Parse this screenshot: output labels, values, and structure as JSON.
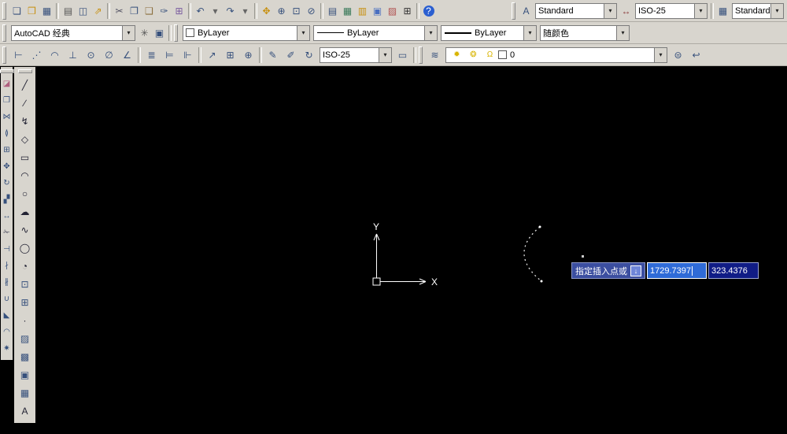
{
  "glyphs": {
    "dropdown": "▾"
  },
  "row1": {
    "icons": [
      {
        "name": "new",
        "glyph": "❏",
        "color": "#36507c"
      },
      {
        "name": "open",
        "glyph": "❒",
        "color": "#c79010"
      },
      {
        "name": "save",
        "glyph": "▦",
        "color": "#36507c"
      },
      {
        "sep": true
      },
      {
        "name": "plot",
        "glyph": "▤",
        "color": "#555555"
      },
      {
        "name": "plot-preview",
        "glyph": "◫",
        "color": "#36507c"
      },
      {
        "name": "publish",
        "glyph": "⇗",
        "color": "#c79010"
      },
      {
        "sep": true
      },
      {
        "name": "cut",
        "glyph": "✂",
        "color": "#555566"
      },
      {
        "name": "copy",
        "glyph": "❐",
        "color": "#36507c"
      },
      {
        "name": "paste",
        "glyph": "❑",
        "color": "#8a6d3b"
      },
      {
        "name": "match-properties",
        "glyph": "✑",
        "color": "#36507c"
      },
      {
        "name": "block-editor",
        "glyph": "⊞",
        "color": "#7a5ca0"
      },
      {
        "sep": true
      },
      {
        "name": "undo",
        "glyph": "↶",
        "color": "#36507c"
      },
      {
        "name": "undo-options",
        "glyph": "▾",
        "color": "#666666"
      },
      {
        "name": "redo",
        "glyph": "↷",
        "color": "#36507c"
      },
      {
        "name": "redo-options",
        "glyph": "▾",
        "color": "#666666"
      },
      {
        "sep": true
      },
      {
        "name": "pan",
        "glyph": "✥",
        "color": "#c79010"
      },
      {
        "name": "zoom-realtime",
        "glyph": "⊕",
        "color": "#36507c"
      },
      {
        "name": "zoom-window",
        "glyph": "⊡",
        "color": "#36507c"
      },
      {
        "name": "zoom-previous",
        "glyph": "⊘",
        "color": "#36507c"
      },
      {
        "sep": true
      },
      {
        "name": "properties",
        "glyph": "▤",
        "color": "#36507c"
      },
      {
        "name": "designcenter",
        "glyph": "▦",
        "color": "#3a7a5a"
      },
      {
        "name": "tool-palettes",
        "glyph": "▥",
        "color": "#c79010"
      },
      {
        "name": "sheet-set-manager",
        "glyph": "▣",
        "color": "#4a6fc0"
      },
      {
        "name": "markup-set-manager",
        "glyph": "▨",
        "color": "#b05050"
      },
      {
        "name": "quickcalc",
        "glyph": "⊞",
        "color": "#333333"
      },
      {
        "sep": true
      },
      {
        "name": "help",
        "glyph": "?",
        "color": "#ffffff",
        "bg": "#2b5fd0",
        "round": true
      }
    ],
    "text_style_icon": "A",
    "text_style": "Standard",
    "dim_style_icon": "↔",
    "dim_style": "ISO-25",
    "table_style_icon": "▦",
    "table_style": "Standard"
  },
  "row2": {
    "workspace": "AutoCAD 经典",
    "settings_icon": "✳",
    "window_icon": "▣",
    "color_swatch": "#ffffff",
    "color_value": "ByLayer",
    "linetype_value": "ByLayer",
    "lineweight_value": "ByLayer",
    "plotstyle_value": "随颜色"
  },
  "row3": {
    "dim_icons": [
      {
        "name": "dim-linear",
        "glyph": "⊢",
        "color": "#36507c"
      },
      {
        "name": "dim-aligned",
        "glyph": "⋰",
        "color": "#36507c"
      },
      {
        "name": "dim-arc-length",
        "glyph": "◠",
        "color": "#36507c"
      },
      {
        "name": "dim-ordinate",
        "glyph": "⊥",
        "color": "#36507c"
      },
      {
        "name": "dim-radius",
        "glyph": "⊙",
        "color": "#36507c"
      },
      {
        "name": "dim-diameter",
        "glyph": "∅",
        "color": "#36507c"
      },
      {
        "name": "dim-angular",
        "glyph": "∠",
        "color": "#36507c"
      },
      {
        "sep": true
      },
      {
        "name": "quick-dimension",
        "glyph": "≣",
        "color": "#36507c"
      },
      {
        "name": "dim-baseline",
        "glyph": "⊨",
        "color": "#36507c"
      },
      {
        "name": "dim-continue",
        "glyph": "⊩",
        "color": "#36507c"
      },
      {
        "sep": true
      },
      {
        "name": "quick-leader",
        "glyph": "↗",
        "color": "#36507c"
      },
      {
        "name": "tolerance",
        "glyph": "⊞",
        "color": "#36507c"
      },
      {
        "name": "center-mark",
        "glyph": "⊕",
        "color": "#36507c"
      },
      {
        "sep": true
      },
      {
        "name": "dim-edit",
        "glyph": "✎",
        "color": "#36507c"
      },
      {
        "name": "dim-text-edit",
        "glyph": "✐",
        "color": "#36507c"
      },
      {
        "name": "dim-update",
        "glyph": "↻",
        "color": "#36507c"
      }
    ],
    "dim_style_value": "ISO-25",
    "dim_style_btn_icon": "▭",
    "layers_icon": "≋",
    "layer_combo_icons": [
      {
        "name": "layer-on",
        "glyph": "✹",
        "color": "#d8b400"
      },
      {
        "name": "layer-thaw",
        "glyph": "❂",
        "color": "#d8b400"
      },
      {
        "name": "layer-unlock",
        "glyph": "Ω",
        "color": "#d8b400"
      }
    ],
    "layer_swatch": "#ffffff",
    "layer_name": "0",
    "layer_right_icons": [
      {
        "name": "make-objects-layer-current",
        "glyph": "⊜",
        "color": "#36507c"
      },
      {
        "name": "layer-previous",
        "glyph": "↩",
        "color": "#36507c"
      }
    ]
  },
  "left_strip": {
    "icons": [
      {
        "name": "erase",
        "glyph": "◪",
        "color": "#b06080"
      },
      {
        "name": "copy-object",
        "glyph": "❐",
        "color": "#36507c"
      },
      {
        "name": "mirror",
        "glyph": "⋈",
        "color": "#36507c"
      },
      {
        "name": "offset",
        "glyph": "≬",
        "color": "#36507c"
      },
      {
        "name": "array",
        "glyph": "⊞",
        "color": "#36507c"
      },
      {
        "name": "move",
        "glyph": "✥",
        "color": "#36507c"
      },
      {
        "name": "rotate",
        "glyph": "↻",
        "color": "#36507c"
      },
      {
        "name": "scale",
        "glyph": "▞",
        "color": "#36507c"
      },
      {
        "name": "stretch",
        "glyph": "↔",
        "color": "#36507c"
      },
      {
        "name": "trim",
        "glyph": "✁",
        "color": "#555566"
      },
      {
        "name": "extend",
        "glyph": "⊣",
        "color": "#36507c"
      },
      {
        "name": "break-at-point",
        "glyph": "∤",
        "color": "#36507c"
      },
      {
        "name": "break",
        "glyph": "∦",
        "color": "#36507c"
      },
      {
        "name": "join",
        "glyph": "∪",
        "color": "#36507c"
      },
      {
        "name": "chamfer",
        "glyph": "◣",
        "color": "#36507c"
      },
      {
        "name": "fillet",
        "glyph": "◠",
        "color": "#36507c"
      },
      {
        "name": "explode",
        "glyph": "✷",
        "color": "#36507c"
      }
    ]
  },
  "draw_toolbar": {
    "icons": [
      {
        "name": "line",
        "glyph": "╱",
        "color": "#222233"
      },
      {
        "name": "construction-line",
        "glyph": "∕",
        "color": "#222233"
      },
      {
        "name": "polyline",
        "glyph": "↯",
        "color": "#222233"
      },
      {
        "name": "polygon",
        "glyph": "◇",
        "color": "#222233"
      },
      {
        "name": "rectangle",
        "glyph": "▭",
        "color": "#222233"
      },
      {
        "name": "arc",
        "glyph": "◠",
        "color": "#222233"
      },
      {
        "name": "circle",
        "glyph": "○",
        "color": "#222233"
      },
      {
        "name": "revision-cloud",
        "glyph": "☁",
        "color": "#222233"
      },
      {
        "name": "spline",
        "glyph": "∿",
        "color": "#222233"
      },
      {
        "name": "ellipse",
        "glyph": "◯",
        "color": "#222233"
      },
      {
        "name": "ellipse-arc",
        "glyph": "◔",
        "color": "#222233"
      },
      {
        "name": "insert-block",
        "glyph": "⊡",
        "color": "#36507c"
      },
      {
        "name": "make-block",
        "glyph": "⊞",
        "color": "#36507c"
      },
      {
        "name": "point",
        "glyph": "∙",
        "color": "#222233"
      },
      {
        "name": "hatch",
        "glyph": "▨",
        "color": "#36507c"
      },
      {
        "name": "gradient",
        "glyph": "▩",
        "color": "#36507c"
      },
      {
        "name": "region",
        "glyph": "▣",
        "color": "#36507c"
      },
      {
        "name": "table",
        "glyph": "▦",
        "color": "#36507c"
      },
      {
        "name": "multiline-text",
        "glyph": "A",
        "color": "#222233"
      }
    ]
  },
  "canvas": {
    "ucs": {
      "x_label": "X",
      "y_label": "Y"
    },
    "dyn_input": {
      "prompt": "指定插入点或",
      "key_icon": "↓",
      "x_value": "1729.7397",
      "y_value": "323.4376",
      "prompt_bg": "#3b4ea0",
      "x_bg": "#2f6bd7",
      "y_bg": "#101c86"
    }
  }
}
